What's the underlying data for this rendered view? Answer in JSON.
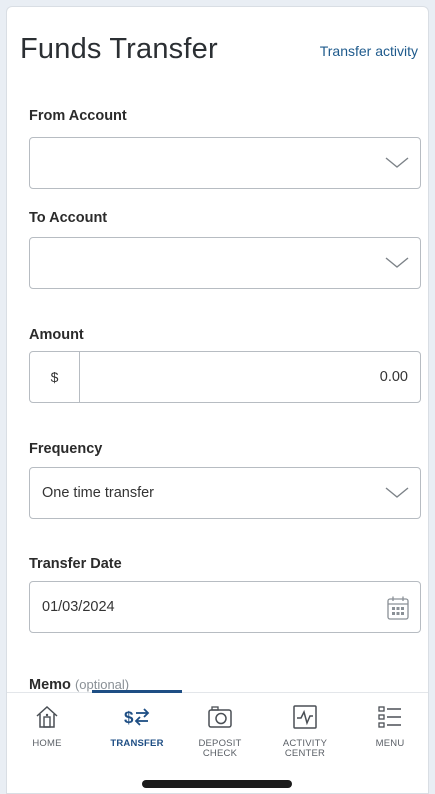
{
  "header": {
    "title": "Funds Transfer",
    "link": "Transfer activity"
  },
  "form": {
    "from_account": {
      "label": "From Account",
      "value": ""
    },
    "to_account": {
      "label": "To Account",
      "value": ""
    },
    "amount": {
      "label": "Amount",
      "currency": "$",
      "value": "0.00"
    },
    "frequency": {
      "label": "Frequency",
      "value": "One time transfer"
    },
    "transfer_date": {
      "label": "Transfer Date",
      "value": "01/03/2024"
    },
    "memo": {
      "label": "Memo",
      "optional": "(optional)"
    }
  },
  "tabs": [
    {
      "label": "HOME",
      "icon": "home-icon",
      "active": false
    },
    {
      "label": "TRANSFER",
      "icon": "transfer-icon",
      "active": true
    },
    {
      "label_line1": "DEPOSIT",
      "label_line2": "CHECK",
      "icon": "camera-icon",
      "active": false
    },
    {
      "label_line1": "ACTIVITY",
      "label_line2": "CENTER",
      "icon": "activity-icon",
      "active": false
    },
    {
      "label": "MENU",
      "icon": "menu-icon",
      "active": false
    }
  ],
  "colors": {
    "accent": "#1e4e84",
    "link": "#1e5a8c",
    "border": "#b7bcc2"
  }
}
